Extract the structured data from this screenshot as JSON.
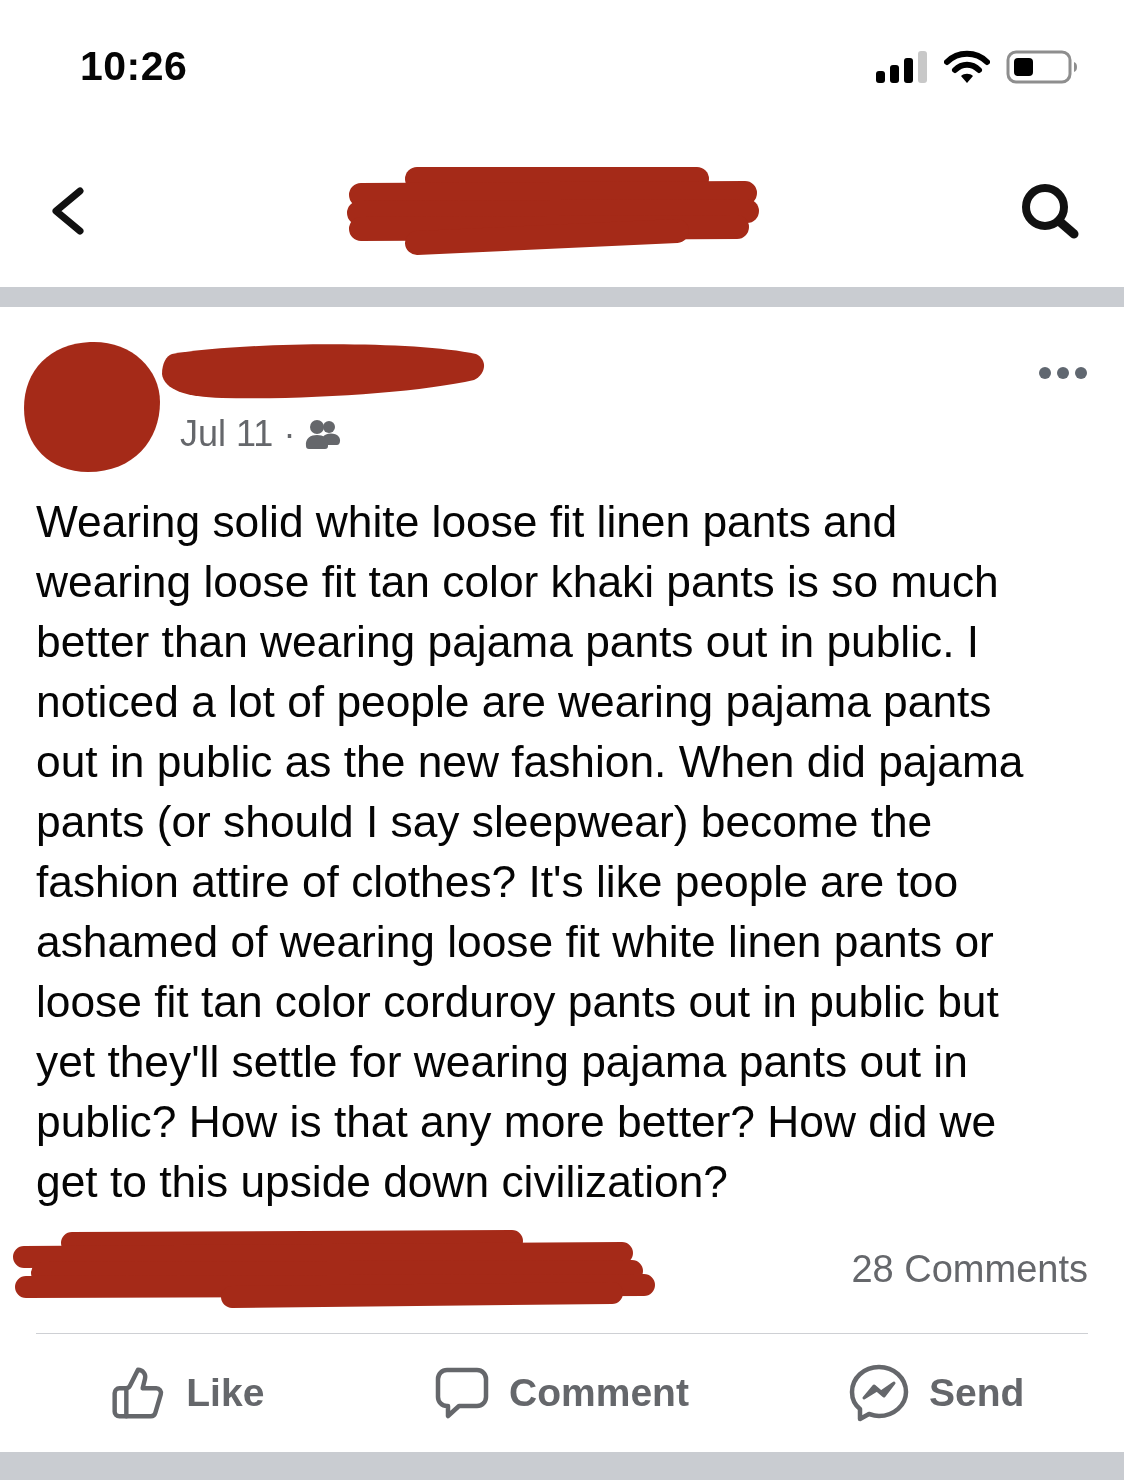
{
  "status_bar": {
    "time": "10:26"
  },
  "nav": {
    "title_redacted": true
  },
  "post": {
    "author": {
      "avatar_redacted": true,
      "name_redacted": true
    },
    "date": "Jul 11",
    "separator": "·",
    "body": "Wearing solid white loose fit linen pants and wearing loose fit tan color khaki pants is so much better than wearing pajama pants out in public. I noticed a lot of people are wearing pajama pants out in public as the new fashion. When did pajama pants (or should I say sleepwear) become the fashion attire of clothes? It's like people are too ashamed of wearing loose fit white linen pants or loose fit tan color corduroy pants out in public but yet they'll settle for wearing pajama pants out in public? How is that any more better? How did we get to this upside down civilization?",
    "reactions_redacted": true,
    "comment_count": "28 Comments"
  },
  "actions": [
    {
      "label": "Like",
      "kind": "like"
    },
    {
      "label": "Comment",
      "kind": "comment"
    },
    {
      "label": "Send",
      "kind": "send"
    }
  ]
}
